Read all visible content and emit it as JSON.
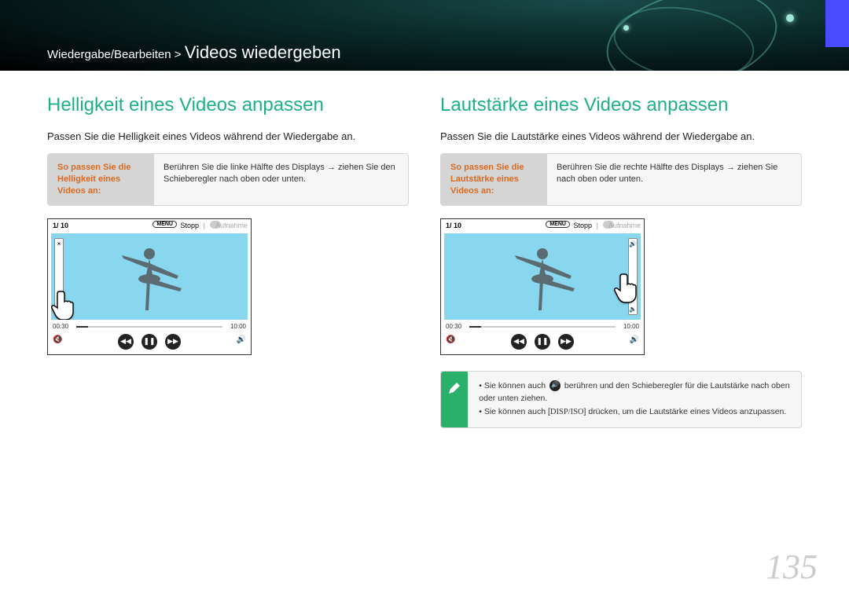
{
  "breadcrumb": {
    "path": "Wiedergabe/Bearbeiten >",
    "title": "Videos wiedergeben"
  },
  "page_number": "135",
  "left": {
    "heading": "Helligkeit eines Videos anpassen",
    "intro": "Passen Sie die Helligkeit eines Videos während der Wiedergabe an.",
    "instr_label": "So passen Sie die Helligkeit eines Videos an:",
    "instr_text": "Berühren Sie die linke Hälfte des Displays → ziehen Sie den Schieberegler nach oben oder unten.",
    "player": {
      "counter": "1/ 10",
      "menu": "MENU",
      "stop": "Stopp",
      "rec": "Aufnahme",
      "time_start": "00:30",
      "time_end": "10:00"
    }
  },
  "right": {
    "heading": "Lautstärke eines Videos anpassen",
    "intro": "Passen Sie die Lautstärke eines Videos während der Wiedergabe an.",
    "instr_label": "So passen Sie die Lautstärke eines Videos an:",
    "instr_text": "Berühren Sie die rechte Hälfte des Displays → ziehen Sie nach oben oder unten.",
    "player": {
      "counter": "1/ 10",
      "menu": "MENU",
      "stop": "Stopp",
      "rec": "Aufnahme",
      "time_start": "00:30",
      "time_end": "10:00"
    },
    "note1a": "Sie können auch ",
    "note1b": " berühren und den Schieberegler für die Lautstärke nach oben oder unten ziehen.",
    "note2a": "Sie können auch [",
    "note2disp": "DISP/ISO",
    "note2b": "] drücken, um die Lautstärke eines Videos anzupassen."
  }
}
